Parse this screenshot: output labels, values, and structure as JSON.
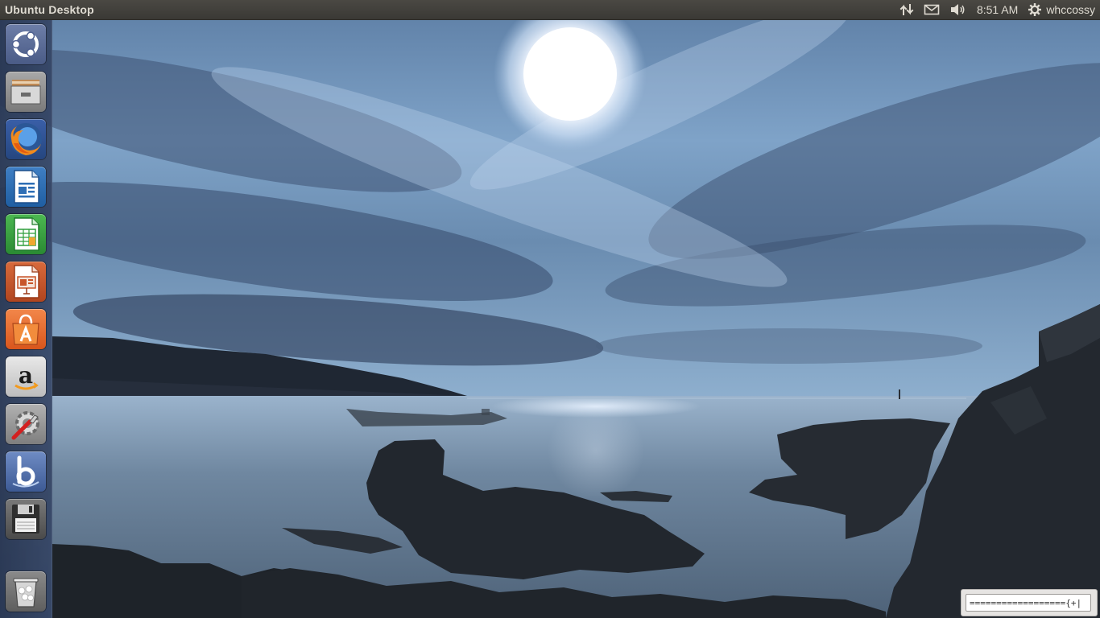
{
  "top_panel": {
    "window_title": "Ubuntu Desktop",
    "clock": "8:51 AM",
    "username": "whccossy",
    "indicators": [
      "network-icon",
      "mail-icon",
      "volume-icon",
      "session-gear-icon"
    ]
  },
  "launcher": {
    "items": [
      {
        "name": "dash-home-icon",
        "color": "#5a6b96"
      },
      {
        "name": "files-icon",
        "color": "#8a8a8a"
      },
      {
        "name": "firefox-icon",
        "color": "#e66000"
      },
      {
        "name": "libreoffice-writer-icon",
        "color": "#2e6eb5"
      },
      {
        "name": "libreoffice-calc-icon",
        "color": "#2e9e3b"
      },
      {
        "name": "libreoffice-impress-icon",
        "color": "#c8552a"
      },
      {
        "name": "ubuntu-software-center-icon",
        "color": "#e8632c"
      },
      {
        "name": "amazon-icon",
        "color": "#d9d9d9"
      },
      {
        "name": "system-settings-icon",
        "color": "#9a9a9a"
      },
      {
        "name": "bluefish-icon",
        "color": "#4f6da8"
      },
      {
        "name": "floppy-save-icon",
        "color": "#5d5d5d"
      },
      {
        "name": "trash-icon",
        "color": "#6e6e6e"
      }
    ]
  },
  "tray_input": {
    "value": "=================={+|"
  },
  "colors": {
    "panel": "#3c3b37",
    "panel_text": "#dfdbd2",
    "launcher": "#2f3f5f"
  }
}
